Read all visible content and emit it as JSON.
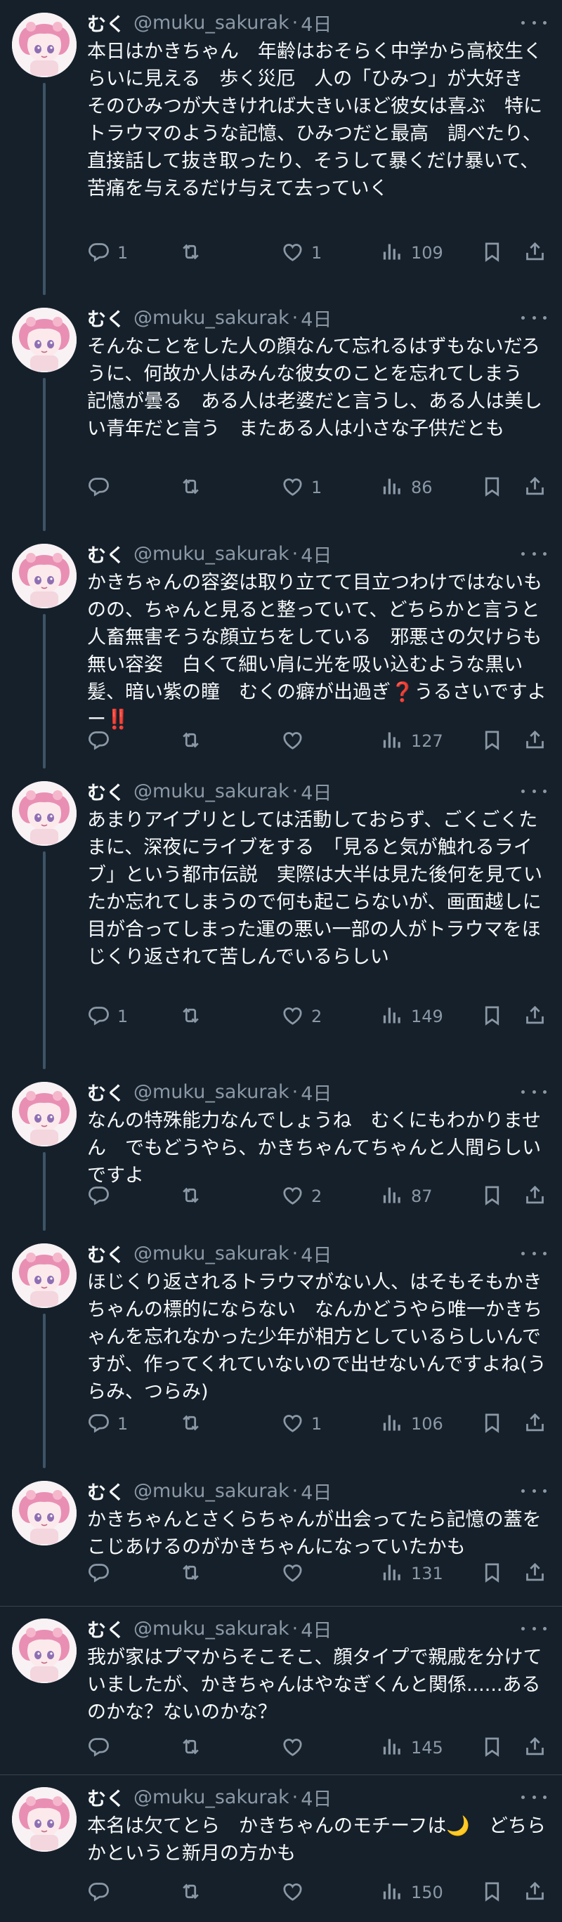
{
  "user": {
    "name": "むく",
    "handle": "@muku_sakurak",
    "separator": "·"
  },
  "tweets": [
    {
      "time": "4日",
      "text": "本日はかきちゃん　年齢はおそらく中学から高校生くらいに見える　歩く災厄　人の「ひみつ」が大好き　そのひみつが大きければ大きいほど彼女は喜ぶ　特にトラウマのような記憶、ひみつだと最高　調べたり、直接話して抜き取ったり、そうして暴くだけ暴いて、苦痛を与えるだけ与えて去っていく",
      "replies": "1",
      "retweets": "",
      "likes": "1",
      "views": "109"
    },
    {
      "time": "4日",
      "text": "そんなことをした人の顔なんて忘れるはずもないだろうに、何故か人はみんな彼女のことを忘れてしまう　記憶が曇る　ある人は老婆だと言うし、ある人は美しい青年だと言う　またある人は小さな子供だとも",
      "replies": "",
      "retweets": "",
      "likes": "1",
      "views": "86"
    },
    {
      "time": "4日",
      "text": "かきちゃんの容姿は取り立てて目立つわけではないものの、ちゃんと見ると整っていて、どちらかと言うと人畜無害そうな顔立ちをしている　邪悪さの欠けらも無い容姿　白くて細い肩に光を吸い込むような黒い髪、暗い紫の瞳　むくの癖が出過ぎ❓うるさいですよー‼️",
      "replies": "",
      "retweets": "",
      "likes": "",
      "views": "127"
    },
    {
      "time": "4日",
      "text": "あまりアイプリとしては活動しておらず、ごくごくたまに、深夜にライブをする　「見ると気が触れるライブ」という都市伝説　実際は大半は見た後何を見ていたか忘れてしまうので何も起こらないが、画面越しに目が合ってしまった運の悪い一部の人がトラウマをほじくり返されて苦しんでいるらしい",
      "replies": "1",
      "retweets": "",
      "likes": "2",
      "views": "149"
    },
    {
      "time": "4日",
      "text": "なんの特殊能力なんでしょうね　むくにもわかりません　でもどうやら、かきちゃんてちゃんと人間らしいですよ",
      "replies": "",
      "retweets": "",
      "likes": "2",
      "views": "87"
    },
    {
      "time": "4日",
      "text": "ほじくり返されるトラウマがない人、はそもそもかきちゃんの標的にならない　なんかどうやら唯一かきちゃんを忘れなかった少年が相方としているらしいんですが、作ってくれていないので出せないんですよね(うらみ、つらみ)",
      "replies": "1",
      "retweets": "",
      "likes": "1",
      "views": "106"
    },
    {
      "time": "4日",
      "text": "かきちゃんとさくらちゃんが出会ってたら記憶の蓋をこじあけるのがかきちゃんになっていたかも",
      "replies": "",
      "retweets": "",
      "likes": "",
      "views": "131"
    },
    {
      "time": "4日",
      "text": "我が家はプマからそこそこ、顔タイプで親戚を分けていましたが、かきちゃんはやなぎくんと関係......あるのかな？ないのかな？",
      "replies": "",
      "retweets": "",
      "likes": "",
      "views": "145"
    },
    {
      "time": "4日",
      "text": "本名は欠てとら　かきちゃんのモチーフは🌙　どちらかというと新月の方かも",
      "replies": "",
      "retweets": "",
      "likes": "",
      "views": "150"
    }
  ],
  "icons": {
    "reply": "reply-icon",
    "retweet": "retweet-icon",
    "like": "heart-icon",
    "views": "views-icon",
    "bookmark": "bookmark-icon",
    "share": "share-icon",
    "more": "more-icon"
  },
  "colors": {
    "background": "#15202b",
    "text": "#f7f9f9",
    "secondary": "#8b98a5",
    "thread_line": "#3d5466",
    "divider": "#38444d",
    "avatar_hair": "#e98fb4"
  }
}
